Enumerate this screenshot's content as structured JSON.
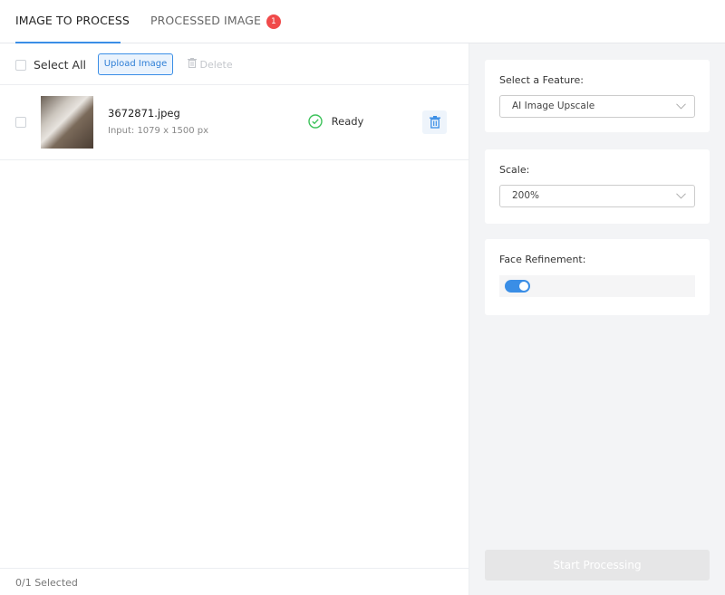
{
  "tabs": [
    {
      "label": "IMAGE TO PROCESS",
      "active": true
    },
    {
      "label": "PROCESSED IMAGE",
      "badge": "1"
    }
  ],
  "toolbar": {
    "select_all_label": "Select All",
    "upload_label": "Upload Image",
    "delete_label": "Delete"
  },
  "files": [
    {
      "name": "3672871.jpeg",
      "size": "Input: 1079 x 1500 px",
      "status": "Ready"
    }
  ],
  "footer": {
    "selected_text": "0/1 Selected"
  },
  "settings": {
    "feature": {
      "label": "Select a Feature:",
      "value": "AI Image Upscale"
    },
    "scale": {
      "label": "Scale:",
      "value": "200%"
    },
    "face_refinement": {
      "label": "Face Refinement:",
      "enabled": true
    }
  },
  "actions": {
    "start_label": "Start Processing"
  },
  "colors": {
    "accent": "#3a8ee6",
    "badge": "#f04a4a",
    "ready": "#3cc25a"
  }
}
